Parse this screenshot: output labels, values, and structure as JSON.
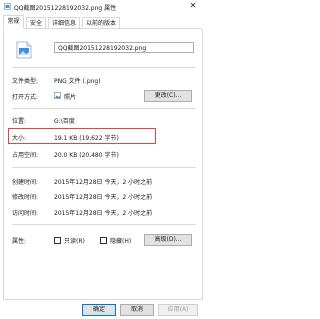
{
  "window": {
    "title": "QQ截图20151228192032.png 属性",
    "close_symbol": "✕"
  },
  "tabs": [
    {
      "label": "常规",
      "active": true
    },
    {
      "label": "安全",
      "active": false
    },
    {
      "label": "详细信息",
      "active": false
    },
    {
      "label": "以前的版本",
      "active": false
    }
  ],
  "file": {
    "name": "QQ截图20151228192032.png",
    "icon": "png-file-icon"
  },
  "props": {
    "type_label": "文件类型:",
    "type_value": "PNG 文件 (.png)",
    "open_with_label": "打开方式:",
    "open_with_value": "照片",
    "change_button": "更改(C)...",
    "location_label": "位置:",
    "location_value": "G:\\百度",
    "size_label": "大小:",
    "size_value": "19.1 KB (19,622 字节)",
    "disk_size_label": "占用空间:",
    "disk_size_value": "20.0 KB (20,480 字节)",
    "created_label": "创建时间:",
    "created_value": "2015年12月28日 今天，2 小时之前",
    "modified_label": "修改时间:",
    "modified_value": "2015年12月28日 今天，2 小时之前",
    "accessed_label": "访问时间:",
    "accessed_value": "2015年12月28日 今天，2 小时之前",
    "attributes_label": "属性:",
    "readonly_label": "只读(R)",
    "hidden_label": "隐藏(H)",
    "advanced_button": "高级(D)..."
  },
  "footer": {
    "ok": "确定",
    "cancel": "取消",
    "apply": "应用(A)"
  },
  "colors": {
    "highlight": "#e2473f",
    "accent": "#0078d7"
  }
}
